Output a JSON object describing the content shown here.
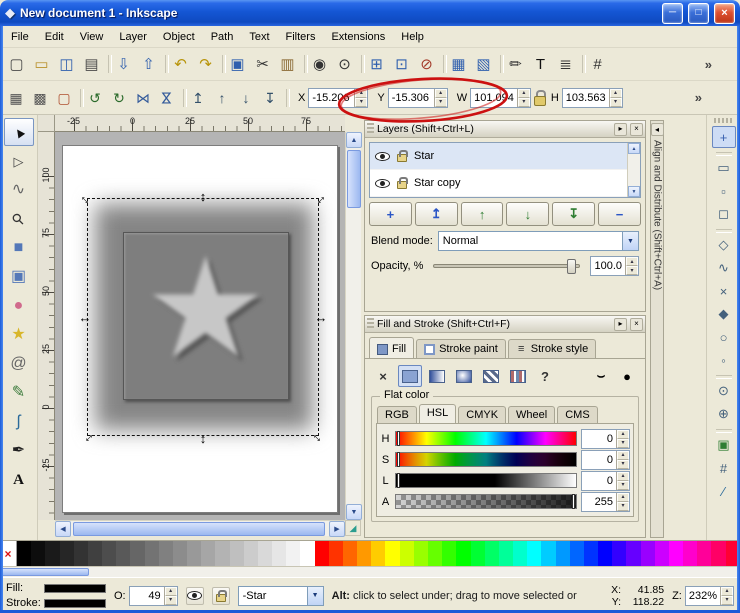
{
  "window": {
    "icon_glyph": "◆",
    "title": "New document 1 - Inkscape",
    "minimize_label": "─",
    "maximize_label": "□",
    "close_label": "×"
  },
  "ui": {
    "spin_up": "▴",
    "spin_down": "▾",
    "dropdown_arrow": "▼",
    "scroll_up": "▲",
    "scroll_down": "▼",
    "scroll_left": "◀",
    "scroll_right": "▶",
    "corner_glyph": "◢",
    "handle_diag": "↔",
    "handle_h": "↔",
    "handle_v": "↕"
  },
  "menubar": {
    "items": [
      {
        "name": "menu-file",
        "label": "File"
      },
      {
        "name": "menu-edit",
        "label": "Edit"
      },
      {
        "name": "menu-view",
        "label": "View"
      },
      {
        "name": "menu-layer",
        "label": "Layer"
      },
      {
        "name": "menu-object",
        "label": "Object"
      },
      {
        "name": "menu-path",
        "label": "Path"
      },
      {
        "name": "menu-text",
        "label": "Text"
      },
      {
        "name": "menu-filters",
        "label": "Filters"
      },
      {
        "name": "menu-extensions",
        "label": "Extensions"
      },
      {
        "name": "menu-help",
        "label": "Help"
      }
    ]
  },
  "command_toolbar": {
    "overflow_label": "»",
    "icons": [
      {
        "name": "new-document-icon",
        "glyph": "▢",
        "color": "#4a4a4a"
      },
      {
        "name": "open-document-icon",
        "glyph": "▭",
        "color": "#b8902a"
      },
      {
        "name": "save-icon",
        "glyph": "◫",
        "color": "#2f5fae"
      },
      {
        "name": "print-icon",
        "glyph": "▤",
        "color": "#4a4a4a"
      },
      {
        "sep": true
      },
      {
        "name": "import-icon",
        "glyph": "⇩",
        "color": "#2f5fae"
      },
      {
        "name": "export-icon",
        "glyph": "⇧",
        "color": "#2f5fae"
      },
      {
        "sep": true
      },
      {
        "name": "undo-icon",
        "glyph": "↶",
        "color": "#b8940a"
      },
      {
        "name": "redo-icon",
        "glyph": "↷",
        "color": "#b8940a"
      },
      {
        "sep": true
      },
      {
        "name": "copy-icon",
        "glyph": "▣",
        "color": "#2f5fae"
      },
      {
        "name": "cut-icon",
        "glyph": "✂",
        "color": "#333333"
      },
      {
        "name": "paste-icon",
        "glyph": "▥",
        "color": "#8a6a34"
      },
      {
        "sep": true
      },
      {
        "name": "zoom-drawing-icon",
        "glyph": "◉",
        "color": "#333333"
      },
      {
        "name": "zoom-page-icon",
        "glyph": "⊙",
        "color": "#333333"
      },
      {
        "sep": true
      },
      {
        "name": "duplicate-icon",
        "glyph": "⊞",
        "color": "#2f5fae"
      },
      {
        "name": "clone-icon",
        "glyph": "⊡",
        "color": "#2f5fae"
      },
      {
        "name": "unlink-clone-icon",
        "glyph": "⊘",
        "color": "#a33b2a"
      },
      {
        "sep": true
      },
      {
        "name": "group-icon",
        "glyph": "▦",
        "color": "#2f5fae"
      },
      {
        "name": "ungroup-icon",
        "glyph": "▧",
        "color": "#2f5fae"
      },
      {
        "sep": true
      },
      {
        "name": "fill-stroke-dialog-icon",
        "glyph": "✏",
        "color": "#333333"
      },
      {
        "name": "text-dialog-icon",
        "glyph": "T",
        "color": "#111111"
      },
      {
        "name": "layers-dialog-icon",
        "glyph": "≣",
        "color": "#333333"
      },
      {
        "sep": true
      },
      {
        "name": "align-dialog-icon",
        "glyph": "#",
        "color": "#333333"
      }
    ]
  },
  "selector_toolbar": {
    "icons": [
      {
        "name": "select-all-icon",
        "glyph": "▦",
        "color": "#555555"
      },
      {
        "name": "select-all-layers-icon",
        "glyph": "▩",
        "color": "#555555"
      },
      {
        "name": "deselect-icon",
        "glyph": "▢",
        "color": "#b05030"
      },
      {
        "sep": true
      },
      {
        "name": "rotate-ccw-icon",
        "glyph": "↺",
        "color": "#2a6a2a"
      },
      {
        "name": "rotate-cw-icon",
        "glyph": "↻",
        "color": "#2a6a2a"
      },
      {
        "name": "flip-horizontal-icon",
        "glyph": "⋈",
        "color": "#335a9a"
      },
      {
        "name": "flip-vertical-icon",
        "glyph": "⋈",
        "color": "#335a9a",
        "rot": true
      },
      {
        "sep": true
      },
      {
        "name": "raise-to-top-icon",
        "glyph": "↥",
        "color": "#33506a"
      },
      {
        "name": "raise-icon",
        "glyph": "↑",
        "color": "#33506a"
      },
      {
        "name": "lower-icon",
        "glyph": "↓",
        "color": "#33506a"
      },
      {
        "name": "lower-to-bottom-icon",
        "glyph": "↧",
        "color": "#33506a"
      },
      {
        "sep": true
      }
    ],
    "x_label": "X",
    "x_value": "-15.206",
    "y_label": "Y",
    "y_value": "-15.306",
    "w_label": "W",
    "w_value": "101.094",
    "h_label": "H",
    "h_value": "103.563",
    "overflow_label": "»"
  },
  "annotation": {
    "color": "#cc1111"
  },
  "toolbox": {
    "tools": [
      {
        "name": "selector-tool",
        "glyph": "▲",
        "color": "#111111",
        "kind": "selector",
        "selected": true
      },
      {
        "name": "node-tool",
        "glyph": "▷",
        "color": "#444444",
        "kind": "node"
      },
      {
        "name": "tweak-tool",
        "glyph": "∿",
        "color": "#666666"
      },
      {
        "name": "zoom-tool",
        "glyph": "⚲",
        "color": "#333333",
        "kind": "zoom"
      },
      {
        "name": "rectangle-tool",
        "glyph": "■",
        "color": "#5478b8"
      },
      {
        "name": "box3d-tool",
        "glyph": "▣",
        "color": "#5478b8"
      },
      {
        "name": "ellipse-tool",
        "glyph": "●",
        "color": "#d06a8c"
      },
      {
        "name": "star-tool",
        "glyph": "★",
        "color": "#d8b62a"
      },
      {
        "name": "spiral-tool",
        "glyph": "@",
        "color": "#666666"
      },
      {
        "name": "pencil-tool",
        "glyph": "✎",
        "color": "#3a7a3a"
      },
      {
        "name": "pen-tool",
        "glyph": "ʃ",
        "color": "#2a6a9a"
      },
      {
        "name": "calligraphy-tool",
        "glyph": "✒",
        "color": "#222222"
      },
      {
        "name": "text-tool",
        "glyph": "A",
        "color": "#111111",
        "kind": "text"
      }
    ]
  },
  "canvas": {
    "h_ruler_labels": [
      "-25",
      "0",
      "25",
      "50",
      "75"
    ],
    "v_ruler_labels": [
      "100",
      "75",
      "50",
      "25",
      "0",
      "-25"
    ]
  },
  "layers_panel": {
    "title": "Layers (Shift+Ctrl+L)",
    "collapse_label": "▸",
    "close_label": "×",
    "rows": [
      {
        "name": "Star",
        "selected": true
      },
      {
        "name": "Star copy",
        "selected": false
      }
    ],
    "buttons": [
      {
        "name": "new-layer-button",
        "glyph": "+",
        "color": "#2b56c6"
      },
      {
        "name": "raise-layer-to-top-button",
        "glyph": "↥",
        "color": "#2b56c6"
      },
      {
        "name": "raise-layer-button",
        "glyph": "↑",
        "color": "#2e7d32"
      },
      {
        "name": "lower-layer-button",
        "glyph": "↓",
        "color": "#2e7d32"
      },
      {
        "name": "lower-layer-to-bottom-button",
        "glyph": "↧",
        "color": "#2e7d32"
      },
      {
        "name": "delete-layer-button",
        "glyph": "−",
        "color": "#2b56c6"
      }
    ],
    "blend_mode_label": "Blend mode:",
    "blend_mode_value": "Normal",
    "opacity_label": "Opacity, %",
    "opacity_value": "100.0"
  },
  "fill_stroke_panel": {
    "title": "Fill and Stroke (Shift+Ctrl+F)",
    "collapse_label": "▸",
    "close_label": "×",
    "tabs": [
      {
        "name": "tab-fill",
        "label": "Fill",
        "kind": "fill",
        "active": true
      },
      {
        "name": "tab-stroke-paint",
        "label": "Stroke paint",
        "kind": "strokepaint"
      },
      {
        "name": "tab-stroke-style",
        "label": "Stroke style",
        "kind": "strokestyle"
      }
    ],
    "paint_buttons": [
      {
        "name": "no-paint-button",
        "glyph": "×",
        "kind": "none"
      },
      {
        "name": "flat-color-button",
        "kind": "flat",
        "selected": true
      },
      {
        "name": "linear-gradient-button",
        "kind": "linear"
      },
      {
        "name": "radial-gradient-button",
        "kind": "radial"
      },
      {
        "name": "pattern-button",
        "kind": "pattern"
      },
      {
        "name": "swatch-button",
        "kind": "swatch"
      },
      {
        "name": "unknown-paint-button",
        "glyph": "?",
        "kind": "unknown"
      }
    ],
    "fill_rule_buttons": [
      {
        "name": "fill-rule-evenodd-button",
        "glyph": "⌣"
      },
      {
        "name": "fill-rule-nonzero-button",
        "glyph": "●"
      }
    ],
    "flat_color_label": "Flat color",
    "color_tabs": [
      {
        "name": "tab-rgb",
        "label": "RGB"
      },
      {
        "name": "tab-hsl",
        "label": "HSL",
        "active": true
      },
      {
        "name": "tab-cmyk",
        "label": "CMYK"
      },
      {
        "name": "tab-wheel",
        "label": "Wheel"
      },
      {
        "name": "tab-cms",
        "label": "CMS"
      }
    ],
    "sliders": [
      {
        "name": "hue-slider",
        "label": "H",
        "value": "0",
        "kind": "hue"
      },
      {
        "name": "saturation-slider",
        "label": "S",
        "value": "0",
        "kind": "saturation"
      },
      {
        "name": "lightness-slider",
        "label": "L",
        "value": "0",
        "kind": "lightness"
      },
      {
        "name": "alpha-slider",
        "label": "A",
        "value": "255",
        "kind": "alpha"
      }
    ]
  },
  "align_panel": {
    "title": "Align and Distribute (Shift+Ctrl+A)",
    "collapse_label": "◂"
  },
  "snap_toolbar": {
    "icons": [
      {
        "name": "toggle-snapping-icon",
        "glyph": "+",
        "color": "#3a62b0",
        "selected": true
      },
      {
        "sep": true
      },
      {
        "name": "snap-bbox-icon",
        "glyph": "▭",
        "color": "#44617c"
      },
      {
        "name": "snap-bbox-edges-icon",
        "glyph": "▫",
        "color": "#44617c"
      },
      {
        "name": "snap-bbox-corners-icon",
        "glyph": "◻",
        "color": "#44617c"
      },
      {
        "sep": true
      },
      {
        "name": "snap-nodes-icon",
        "glyph": "◇",
        "color": "#44617c"
      },
      {
        "name": "snap-paths-icon",
        "glyph": "∿",
        "color": "#44617c"
      },
      {
        "name": "snap-intersections-icon",
        "glyph": "×",
        "color": "#44617c"
      },
      {
        "name": "snap-cusp-nodes-icon",
        "glyph": "◆",
        "color": "#44617c"
      },
      {
        "name": "snap-smooth-nodes-icon",
        "glyph": "○",
        "color": "#44617c"
      },
      {
        "name": "snap-midpoints-icon",
        "glyph": "◦",
        "color": "#44617c"
      },
      {
        "sep": true
      },
      {
        "name": "snap-object-centers-icon",
        "glyph": "⊙",
        "color": "#44617c"
      },
      {
        "name": "snap-rotation-centers-icon",
        "glyph": "⊕",
        "color": "#44617c"
      },
      {
        "sep": true
      },
      {
        "name": "snap-page-border-icon",
        "glyph": "▣",
        "color": "#2e7d32"
      },
      {
        "name": "snap-grids-icon",
        "glyph": "#",
        "color": "#44617c"
      },
      {
        "name": "snap-guides-icon",
        "glyph": "∕",
        "color": "#2a6a9a"
      }
    ]
  },
  "palette": {
    "none_glyph": "×",
    "colors": [
      "#000000",
      "#0d0d0d",
      "#1a1a1a",
      "#262626",
      "#333333",
      "#404040",
      "#4d4d4d",
      "#595959",
      "#666666",
      "#737373",
      "#808080",
      "#8c8c8c",
      "#999999",
      "#a6a6a6",
      "#b3b3b3",
      "#bfbfbf",
      "#cccccc",
      "#d9d9d9",
      "#e6e6e6",
      "#f2f2f2",
      "#ffffff",
      "#ff0000",
      "#ff3300",
      "#ff6600",
      "#ff9900",
      "#ffcc00",
      "#ffff00",
      "#ccff00",
      "#99ff00",
      "#66ff00",
      "#33ff00",
      "#00ff00",
      "#00ff33",
      "#00ff66",
      "#00ff99",
      "#00ffcc",
      "#00ffff",
      "#00ccff",
      "#0099ff",
      "#0066ff",
      "#0033ff",
      "#0000ff",
      "#3300ff",
      "#6600ff",
      "#9900ff",
      "#cc00ff",
      "#ff00ff",
      "#ff00cc",
      "#ff0099",
      "#ff0066",
      "#ff0033"
    ]
  },
  "statusbar": {
    "fill_label": "Fill:",
    "stroke_label": "Stroke:",
    "fill_color": "#000000",
    "stroke_color": "#000000",
    "opacity_label": "O:",
    "opacity_value": "49",
    "layer_value": "-Star",
    "message_bold": "Alt:",
    "message_rest": " click to select under; drag to move selected or",
    "x_label": "X:",
    "x_value": "41.85",
    "y_label": "Y:",
    "y_value": "118.22",
    "zoom_label": "Z:",
    "zoom_value": "232%"
  }
}
